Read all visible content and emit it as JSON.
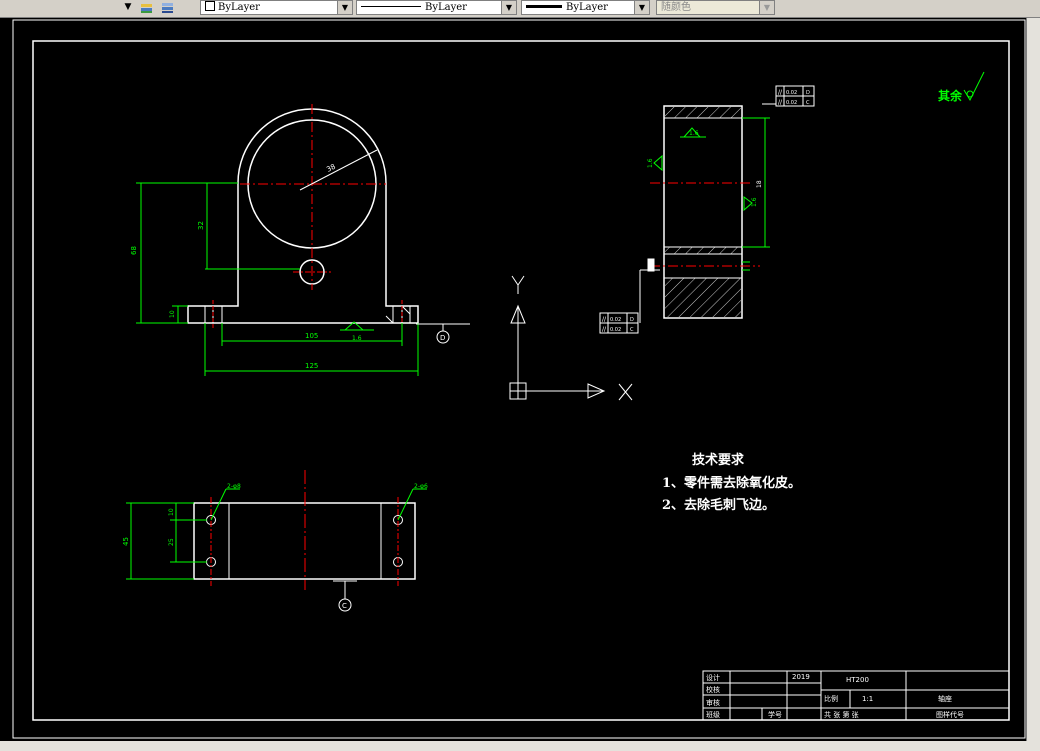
{
  "toolbar": {
    "layer_combo": {
      "value": "ByLayer"
    },
    "linetype_combo": {
      "value": "ByLayer"
    },
    "lineweight_combo": {
      "value": "ByLayer"
    },
    "plotstyle_combo": {
      "value": "随颜色"
    }
  },
  "drawing": {
    "front_view": {
      "radius_label": "38",
      "dim_height_32": "32",
      "dim_height_68": "68",
      "dim_base_10": "10",
      "dim_105": "105",
      "dim_125": "125",
      "roughness_base": "1.6"
    },
    "side_view": {
      "roughness_top": "1.6",
      "roughness_left": "1.6",
      "roughness_right": "1.6",
      "tol_top_1": "0.02",
      "tol_top_1_ref": "D",
      "tol_top_2": "0.02",
      "tol_top_2_ref": "C",
      "tol_bot_1": "0.02",
      "tol_bot_1_ref": "D",
      "tol_bot_2": "0.02",
      "tol_bot_2_ref": "C",
      "dim_side": "18"
    },
    "top_view": {
      "hole_left": "2-φ8",
      "hole_right": "2-φ6",
      "dim_10": "10",
      "dim_25": "25",
      "dim_45": "45",
      "datum_label": "C"
    },
    "front_datum": "D",
    "remaining_roughness": "其余",
    "ucs": {
      "x_label": "X",
      "y_label": "Y"
    },
    "tech_requirements": {
      "title": "技术要求",
      "item1": "1、零件需去除氧化皮。",
      "item2": "2、去除毛刺飞边。"
    },
    "title_block": {
      "design": "设计",
      "check": "校核",
      "review": "审核",
      "class": "班级",
      "student_no": "学号",
      "year": "2019",
      "material": "HT200",
      "scale_label": "比例",
      "scale_value": "1:1",
      "part_name": "轴座",
      "sheet_info": "共   张  第   张",
      "drawing_no": "图样代号"
    }
  },
  "colors": {
    "canvas": "#000000",
    "outline": "#ffffff",
    "center": "#ff0000",
    "dimension": "#00ff00",
    "toolbar": "#d4d0c8"
  }
}
